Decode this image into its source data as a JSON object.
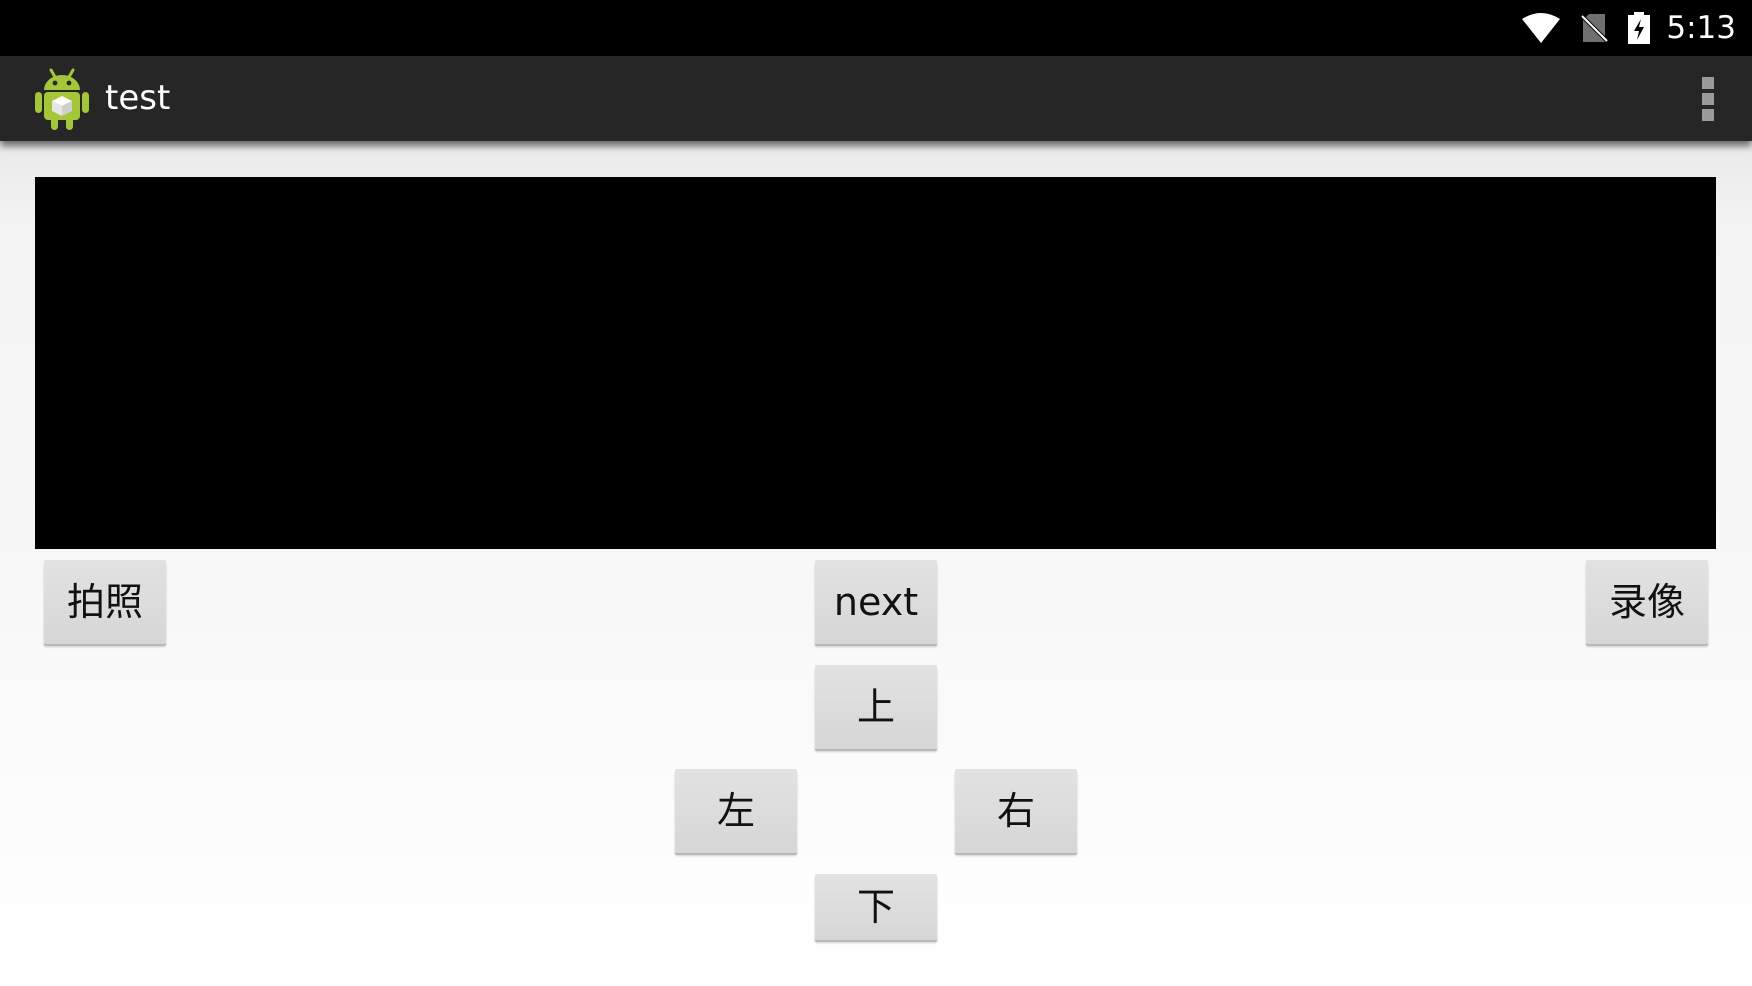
{
  "status_bar": {
    "time": "5:13",
    "icons": [
      "wifi-icon",
      "no-sim-icon",
      "battery-charging-icon"
    ]
  },
  "action_bar": {
    "app_icon": "android-robot-icon",
    "title": "test",
    "overflow_icon": "overflow-menu-icon"
  },
  "buttons": {
    "capture": "拍照",
    "next": "next",
    "record": "录像",
    "up": "上",
    "left": "左",
    "right": "右",
    "down": "下"
  },
  "colors": {
    "status_bar": "#000000",
    "action_bar": "#262626",
    "android_green": "#a4c639",
    "button": "#dcdcdc",
    "preview": "#000000"
  }
}
